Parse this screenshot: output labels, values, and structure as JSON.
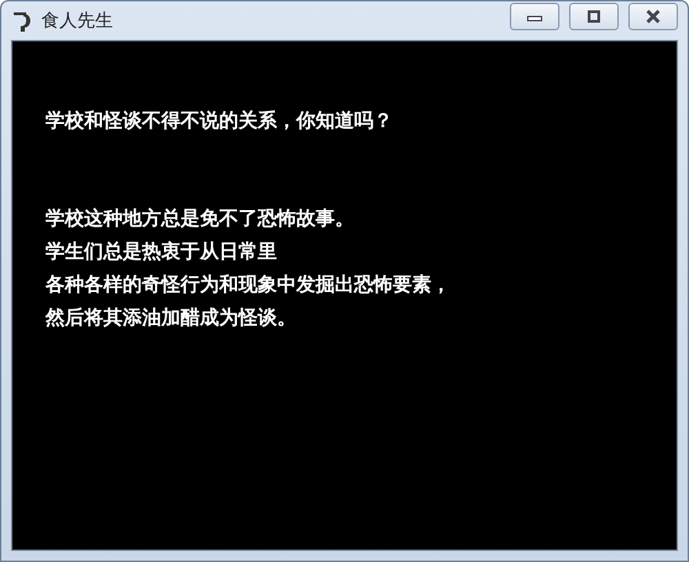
{
  "window": {
    "title": "食人先生"
  },
  "paragraphs": [
    [
      "学校和怪谈不得不说的关系，你知道吗？"
    ],
    [
      "学校这种地方总是免不了恐怖故事。",
      "学生们总是热衷于从日常里",
      "各种各样的奇怪行为和现象中发掘出恐怖要素，",
      "然后将其添油加醋成为怪谈。"
    ]
  ]
}
